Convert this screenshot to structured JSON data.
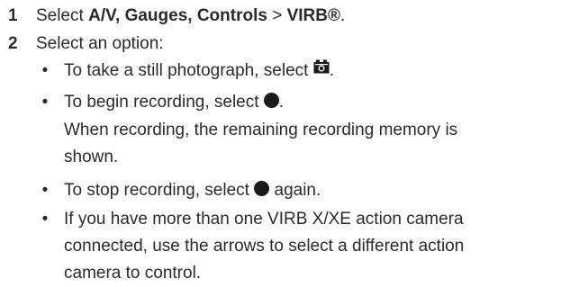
{
  "step1": {
    "number": "1",
    "prefix": "Select ",
    "menu1": "A/V, Gauges, Controls",
    "separator": " > ",
    "menu2": "VIRB®",
    "suffix": "."
  },
  "step2": {
    "number": "2",
    "text": "Select an option:"
  },
  "bullets": {
    "b1": {
      "text": "To take a still photograph, select ",
      "icon": "camera-icon",
      "end": "."
    },
    "b2": {
      "text": "To begin recording, select ",
      "icon": "record-icon",
      "end": "."
    },
    "b2_note": {
      "line1": "When recording, the remaining recording memory is",
      "line2": "shown."
    },
    "b3": {
      "text": "To stop recording, select ",
      "icon": "record-icon",
      "end": " again."
    },
    "b4": {
      "line1": "If you have more than one VIRB X/XE action camera",
      "line2": "connected, use the arrows to select a different action",
      "line3": "camera to control."
    }
  },
  "bullet_glyph": "•"
}
